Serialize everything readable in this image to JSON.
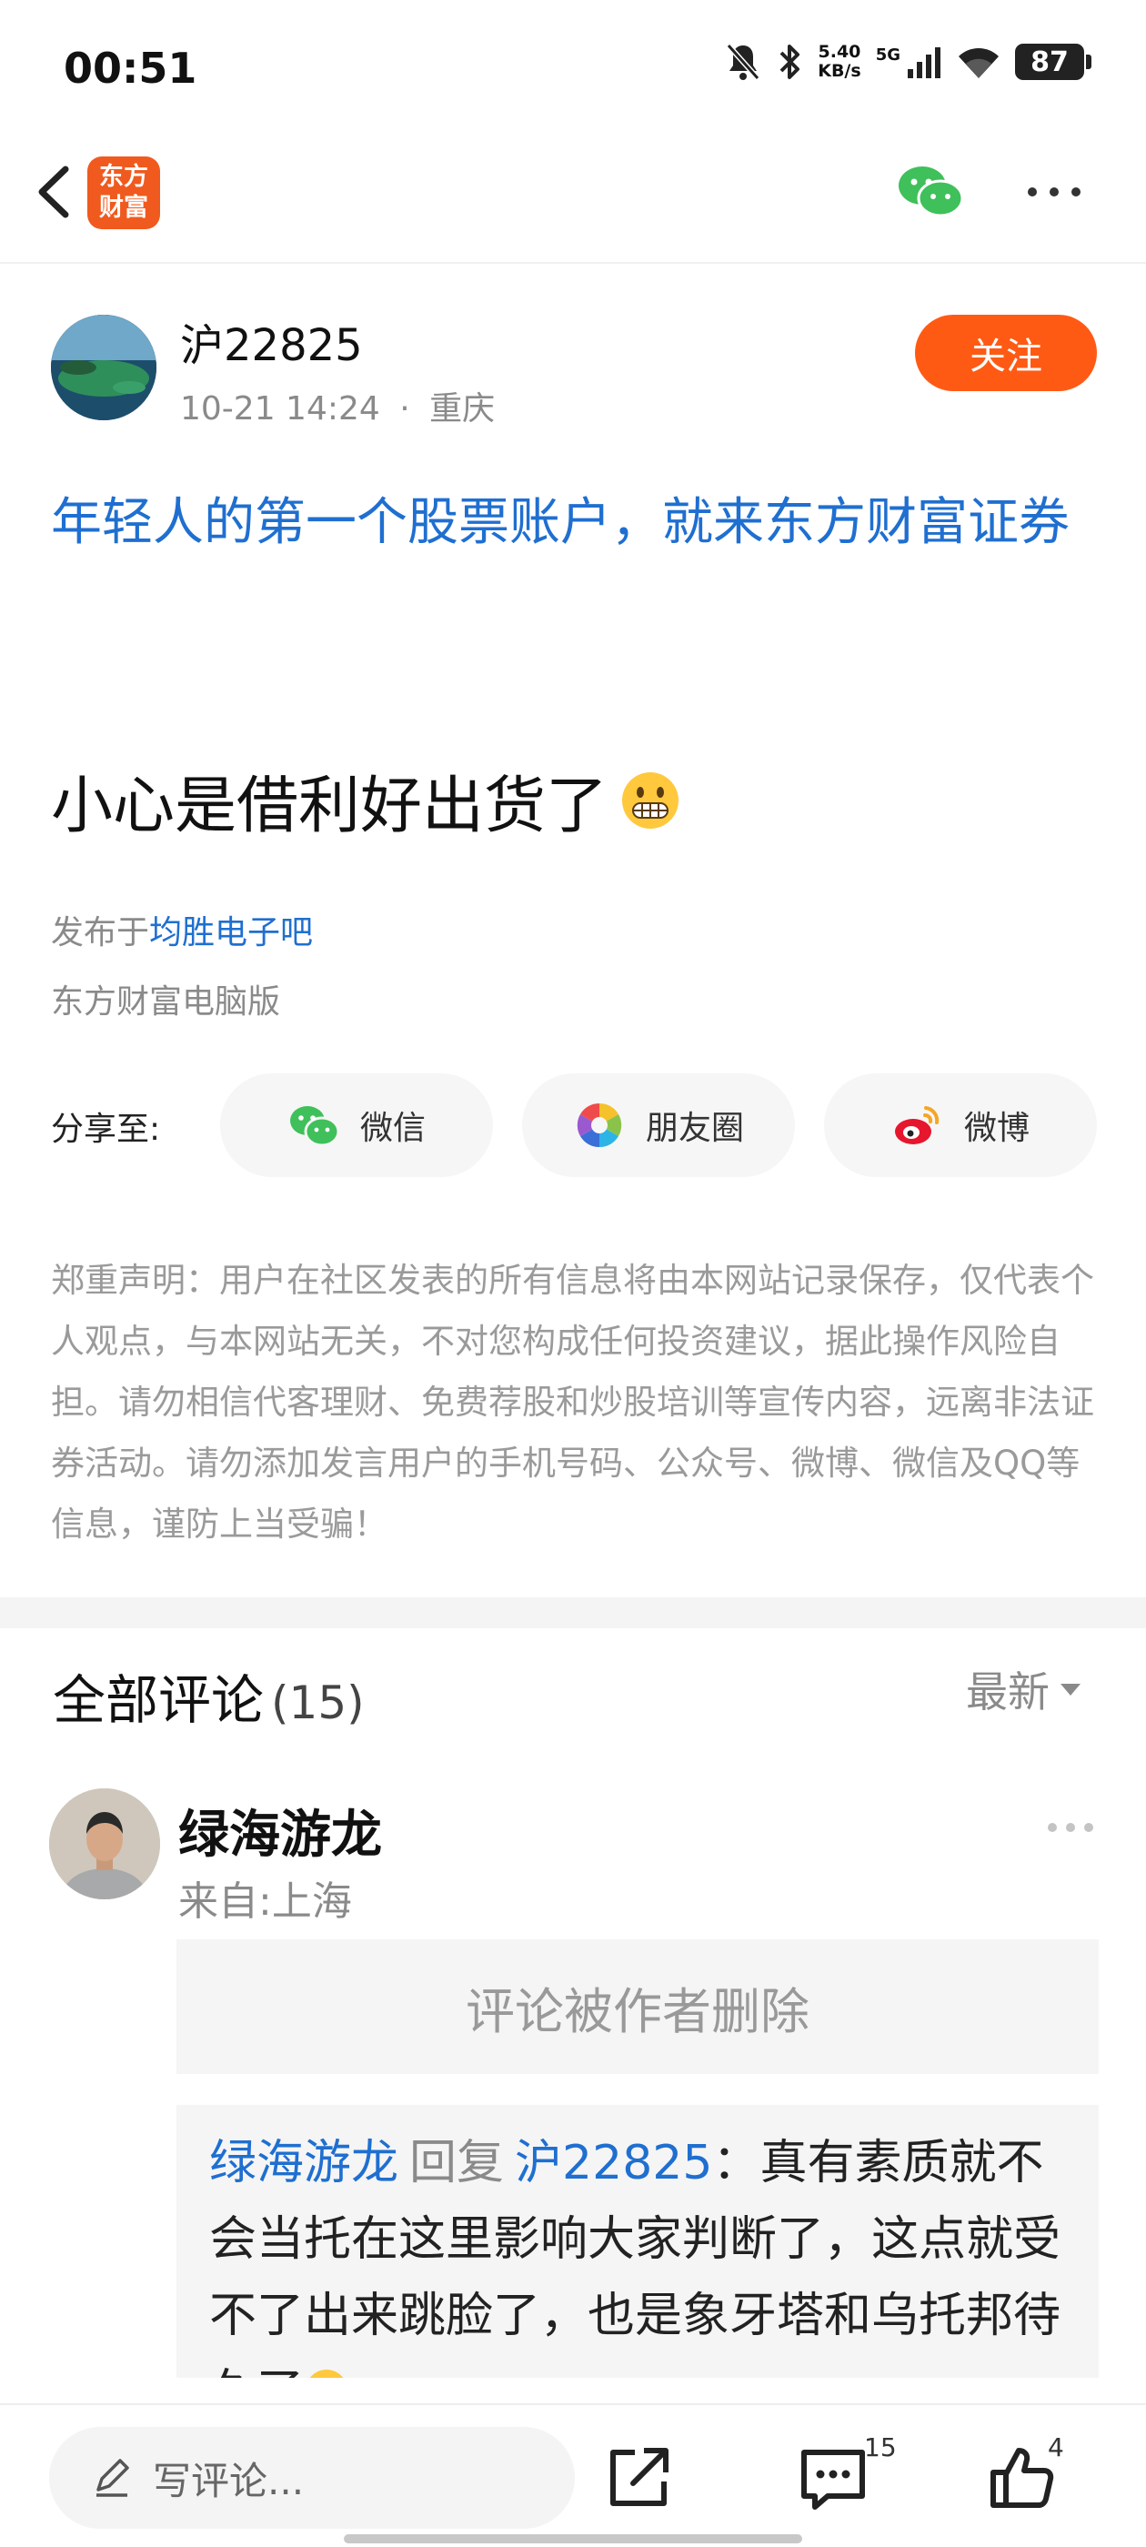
{
  "status_bar": {
    "time": "00:51",
    "net_speed_value": "5.40",
    "net_speed_unit": "KB/s",
    "network": "5G",
    "battery": "87",
    "icons": [
      "mute-bell-icon",
      "bluetooth-icon",
      "signal-icon",
      "wifi-icon",
      "battery-icon"
    ]
  },
  "nav": {
    "logo_line1": "东方",
    "logo_line2": "财富",
    "icons": [
      "back-arrow-icon",
      "wechat-icon",
      "more-icon"
    ]
  },
  "post": {
    "author_name": "沪22825",
    "time": "10-21 14:24",
    "separator": "·",
    "location": "重庆",
    "follow_label": "关注",
    "promo_text": "年轻人的第一个股票账户，就来东方财富证券",
    "title": "小心是借利好出货了",
    "published_prefix": "发布于",
    "forum_name": "均胜电子吧",
    "source": "东方财富电脑版"
  },
  "share": {
    "label": "分享至:",
    "targets": [
      {
        "label": "微信",
        "icon": "wechat-icon"
      },
      {
        "label": "朋友圈",
        "icon": "moments-icon"
      },
      {
        "label": "微博",
        "icon": "weibo-icon"
      }
    ]
  },
  "disclaimer": "郑重声明：用户在社区发表的所有信息将由本网站记录保存，仅代表个人观点，与本网站无关，不对您构成任何投资建议，据此操作风险自担。请勿相信代客理财、免费荐股和炒股培训等宣传内容，远离非法证券活动。请勿添加发言用户的手机号码、公众号、微博、微信及QQ等信息，谨防上当受骗！",
  "comments": {
    "title": "全部评论",
    "count": "(15)",
    "sort_label": "最新",
    "items": [
      {
        "name": "绿海游龙",
        "location": "来自:上海",
        "deleted_text": "评论被作者删除",
        "reply_from": "绿海游龙",
        "reply_verb": "回复",
        "reply_to": "沪22825",
        "reply_text": "：真有素质就不会当托在这里影响大家判断了，这点就受不了出来跳脸了，也是象牙塔和乌托邦待久了"
      }
    ]
  },
  "bottom_bar": {
    "write_placeholder": "写评论...",
    "comment_count": "15",
    "like_count": "4",
    "icons": [
      "pencil-icon",
      "share-out-icon",
      "comment-icon",
      "thumbs-up-icon"
    ]
  },
  "colors": {
    "accent_orange": "#ff5a14",
    "link_blue": "#1f6fd0",
    "logo_orange": "#f05a1e",
    "wechat_green": "#3fc05a"
  }
}
